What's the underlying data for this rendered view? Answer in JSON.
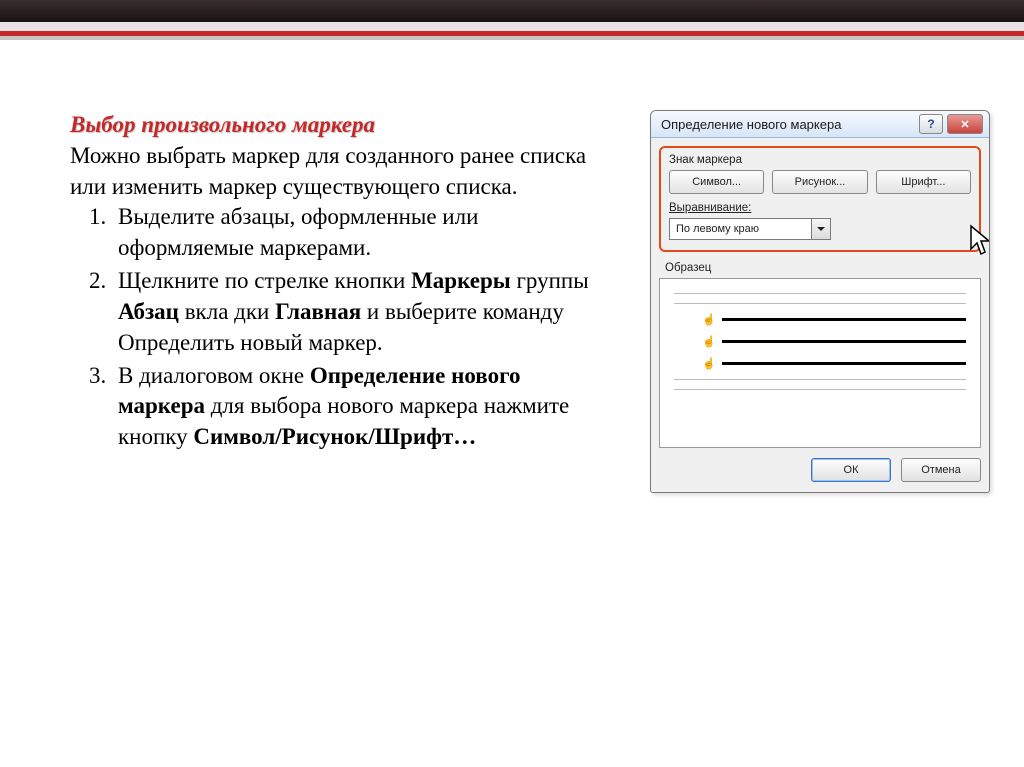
{
  "document": {
    "heading": "Выбор произвольного маркера",
    "intro": "Можно выбрать маркер для созданного ранее списка или изменить маркер существующего списка.",
    "steps": {
      "s1": "Выделите абзацы, оформленные или оформляемые маркерами.",
      "s2a": "Щелкните по стрелке кнопки ",
      "s2b_markers": "Маркеры",
      "s2c": " группы ",
      "s2d_paragraph": "Абзац",
      "s2e": " вкла дки ",
      "s2f_main": "Главная",
      "s2g": " и выберите команду Определить новый маркер.",
      "s3a": "В диалоговом окне ",
      "s3b_dialog": "Определение нового маркера",
      "s3c": " для выбора нового маркера нажмите кнопку ",
      "s3d_btns": "Символ/Рисунок/Шрифт…"
    }
  },
  "dialog": {
    "title": "Определение нового маркера",
    "helpbtn": "?",
    "closebtn": "✕",
    "group_label": "Знак маркера",
    "btn_symbol": "Символ...",
    "btn_picture": "Рисунок...",
    "btn_font": "Шрифт...",
    "align_label": "Выравнивание:",
    "align_value": "По левому краю",
    "preview_label": "Образец",
    "bullet_glyph": "☝",
    "ok": "ОК",
    "cancel": "Отмена"
  }
}
